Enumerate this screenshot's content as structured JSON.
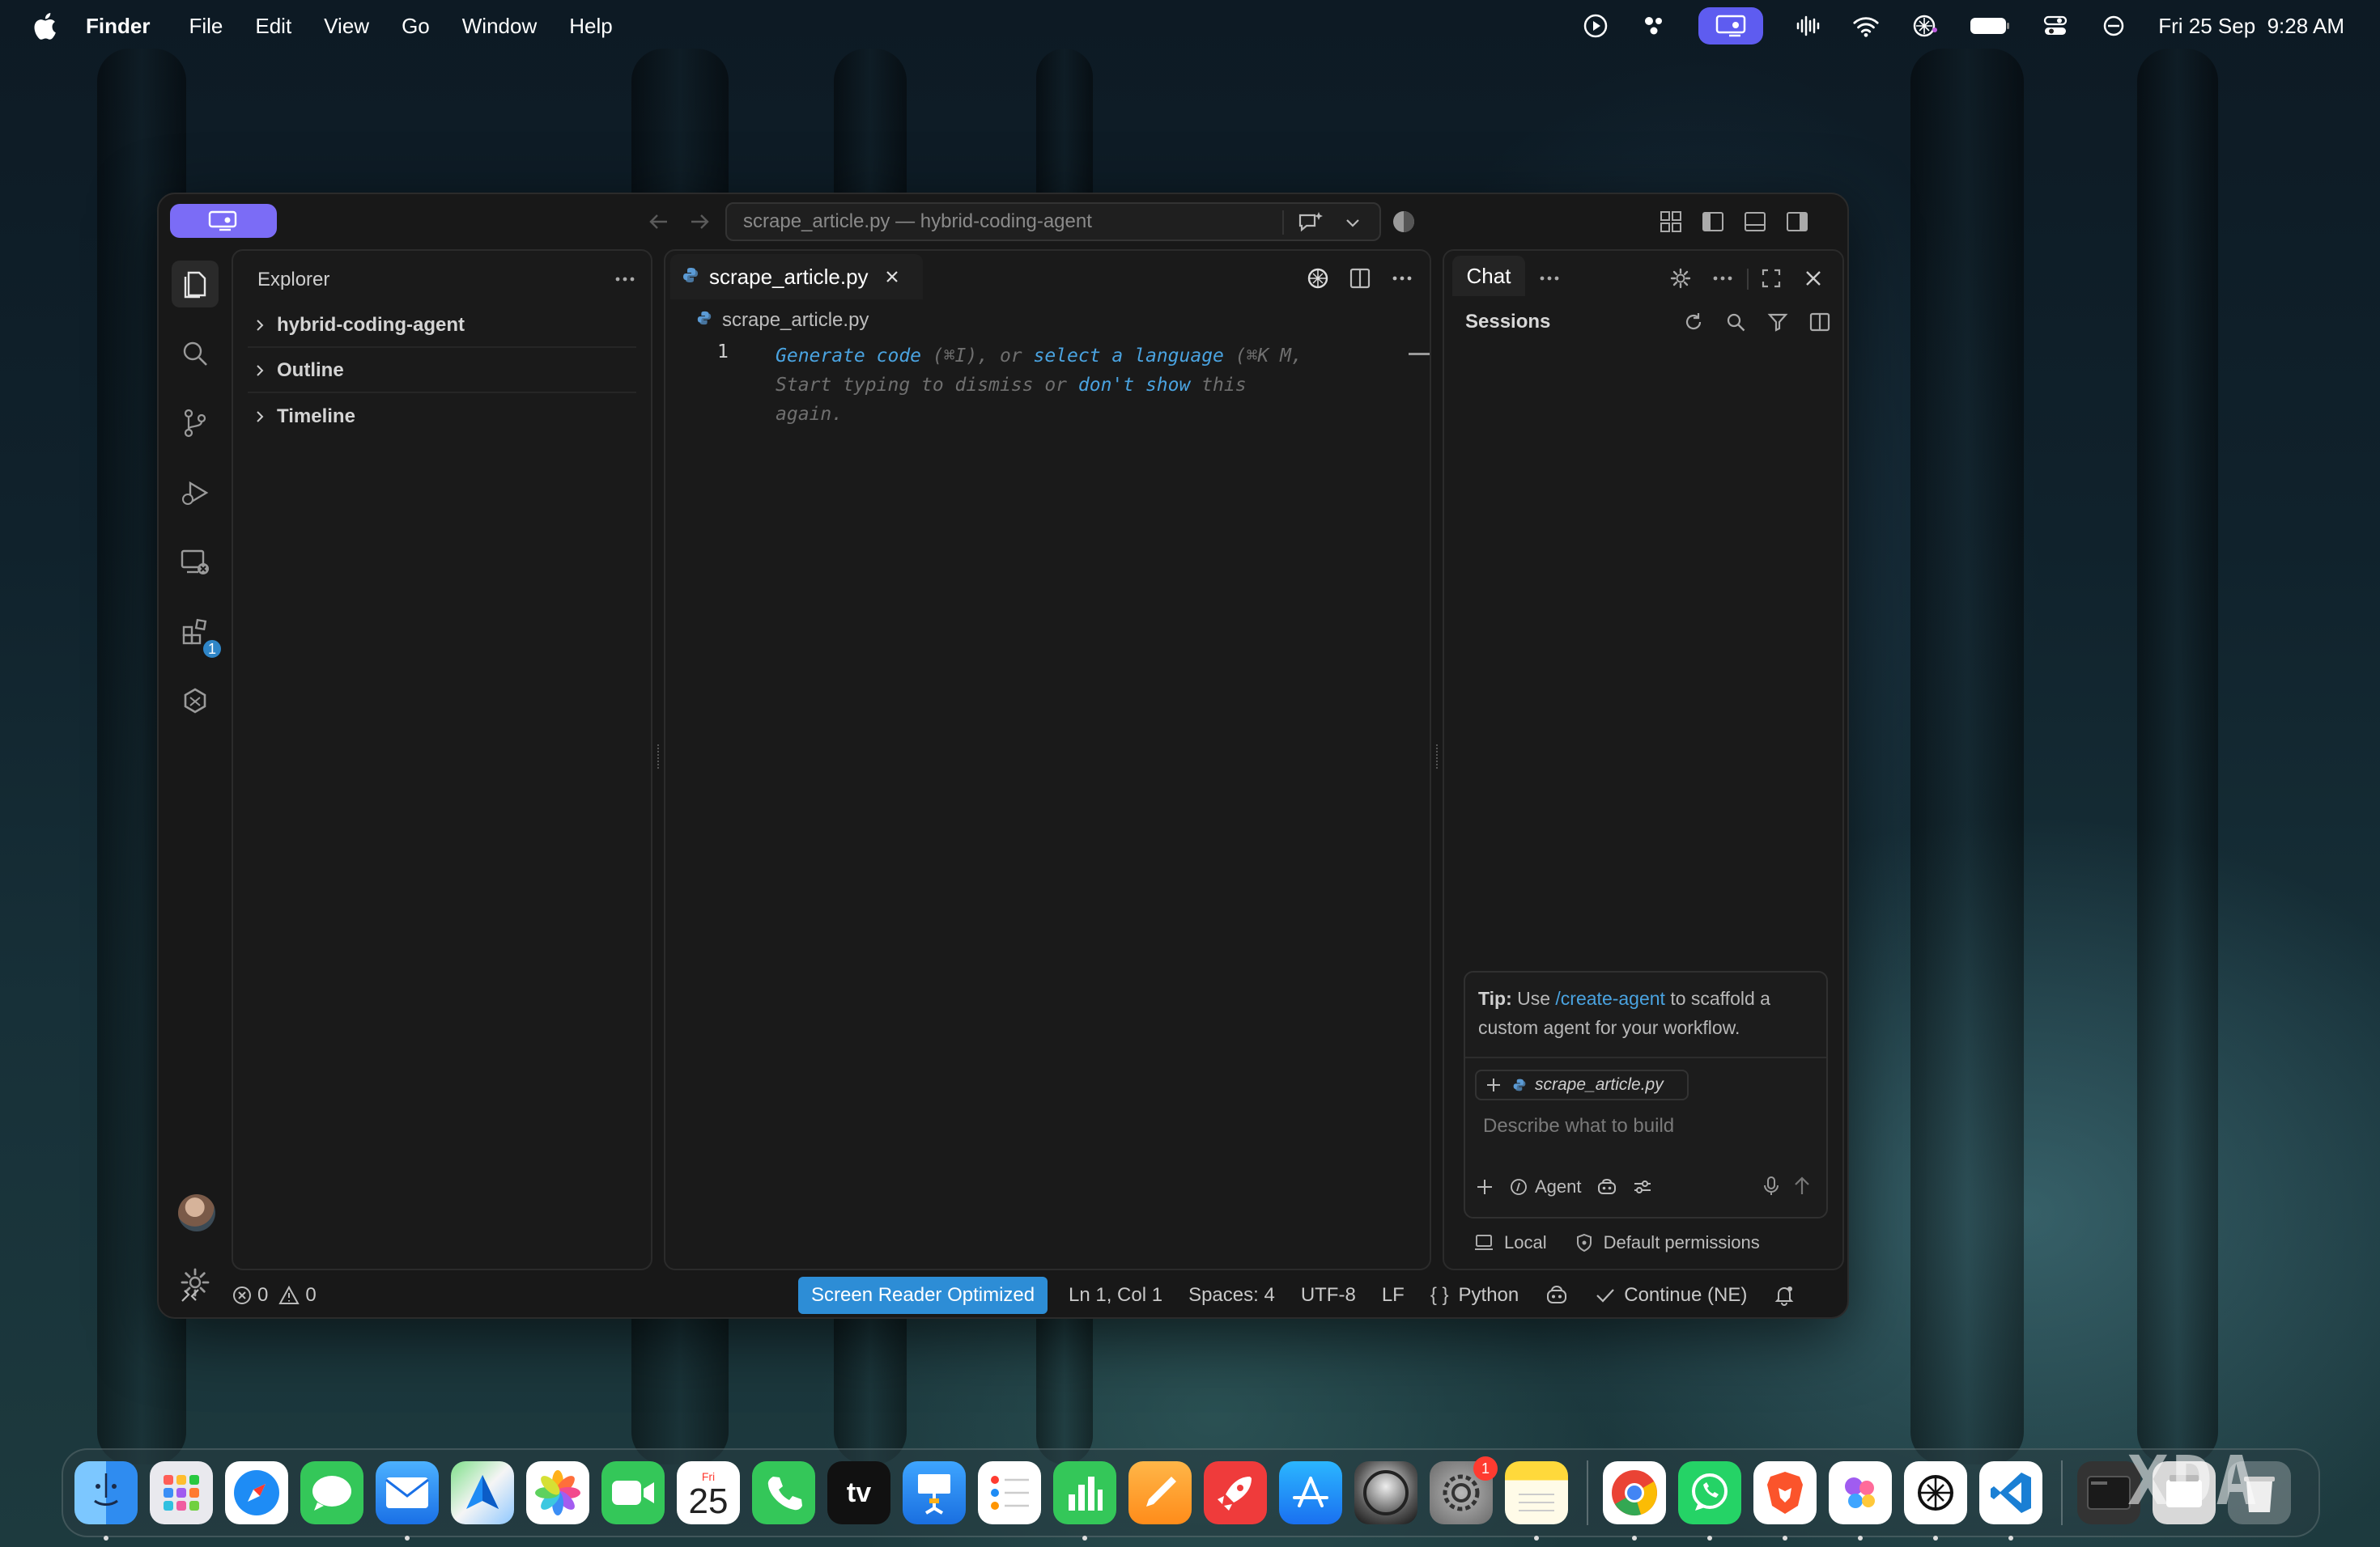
{
  "menubar": {
    "app": "Finder",
    "items": [
      "File",
      "Edit",
      "View",
      "Go",
      "Window",
      "Help"
    ],
    "datetime": "Fri 25 Sep  9:28 AM"
  },
  "window": {
    "title": "scrape_article.py — hybrid-coding-agent"
  },
  "explorer": {
    "title": "Explorer",
    "sections": [
      "hybrid-coding-agent",
      "Outline",
      "Timeline"
    ]
  },
  "editor": {
    "tab_label": "scrape_article.py",
    "breadcrumb": "scrape_article.py",
    "line_number": "1",
    "hint": {
      "generate": "Generate code",
      "gen_key": " (⌘I), or ",
      "select": "select a language",
      "sel_key": " (⌘K M,",
      "start": "Start typing to dismiss or ",
      "dont": "don't show",
      "this": " this",
      "again": "again."
    }
  },
  "chat": {
    "tab_label": "Chat",
    "sessions_label": "Sessions",
    "tip_prefix": "Tip:",
    "tip_mid1": " Use ",
    "tip_command": "/create-agent",
    "tip_mid2": " to scaffold a custom agent for your workflow.",
    "context_file": "scrape_article.py",
    "input_placeholder": "Describe what to build",
    "mode_label": "Agent",
    "footer_local": "Local",
    "footer_permissions": "Default permissions"
  },
  "statusbar": {
    "errors": "0",
    "warnings": "0",
    "screen_reader": "Screen Reader Optimized",
    "position": "Ln 1, Col 1",
    "spaces": "Spaces: 4",
    "encoding": "UTF-8",
    "eol": "LF",
    "language": "Python",
    "continue": "Continue (NE)"
  },
  "activity_badge": "1",
  "dock": {
    "calendar_month": "Fri",
    "calendar_day": "25",
    "tv_label": "tv",
    "settings_badge": "1"
  },
  "watermark": "XDA",
  "colors": {
    "accent_blue": "#2d8dd6",
    "link_blue": "#4aa3e0",
    "titlebar_pill": "#7b6cf6"
  }
}
